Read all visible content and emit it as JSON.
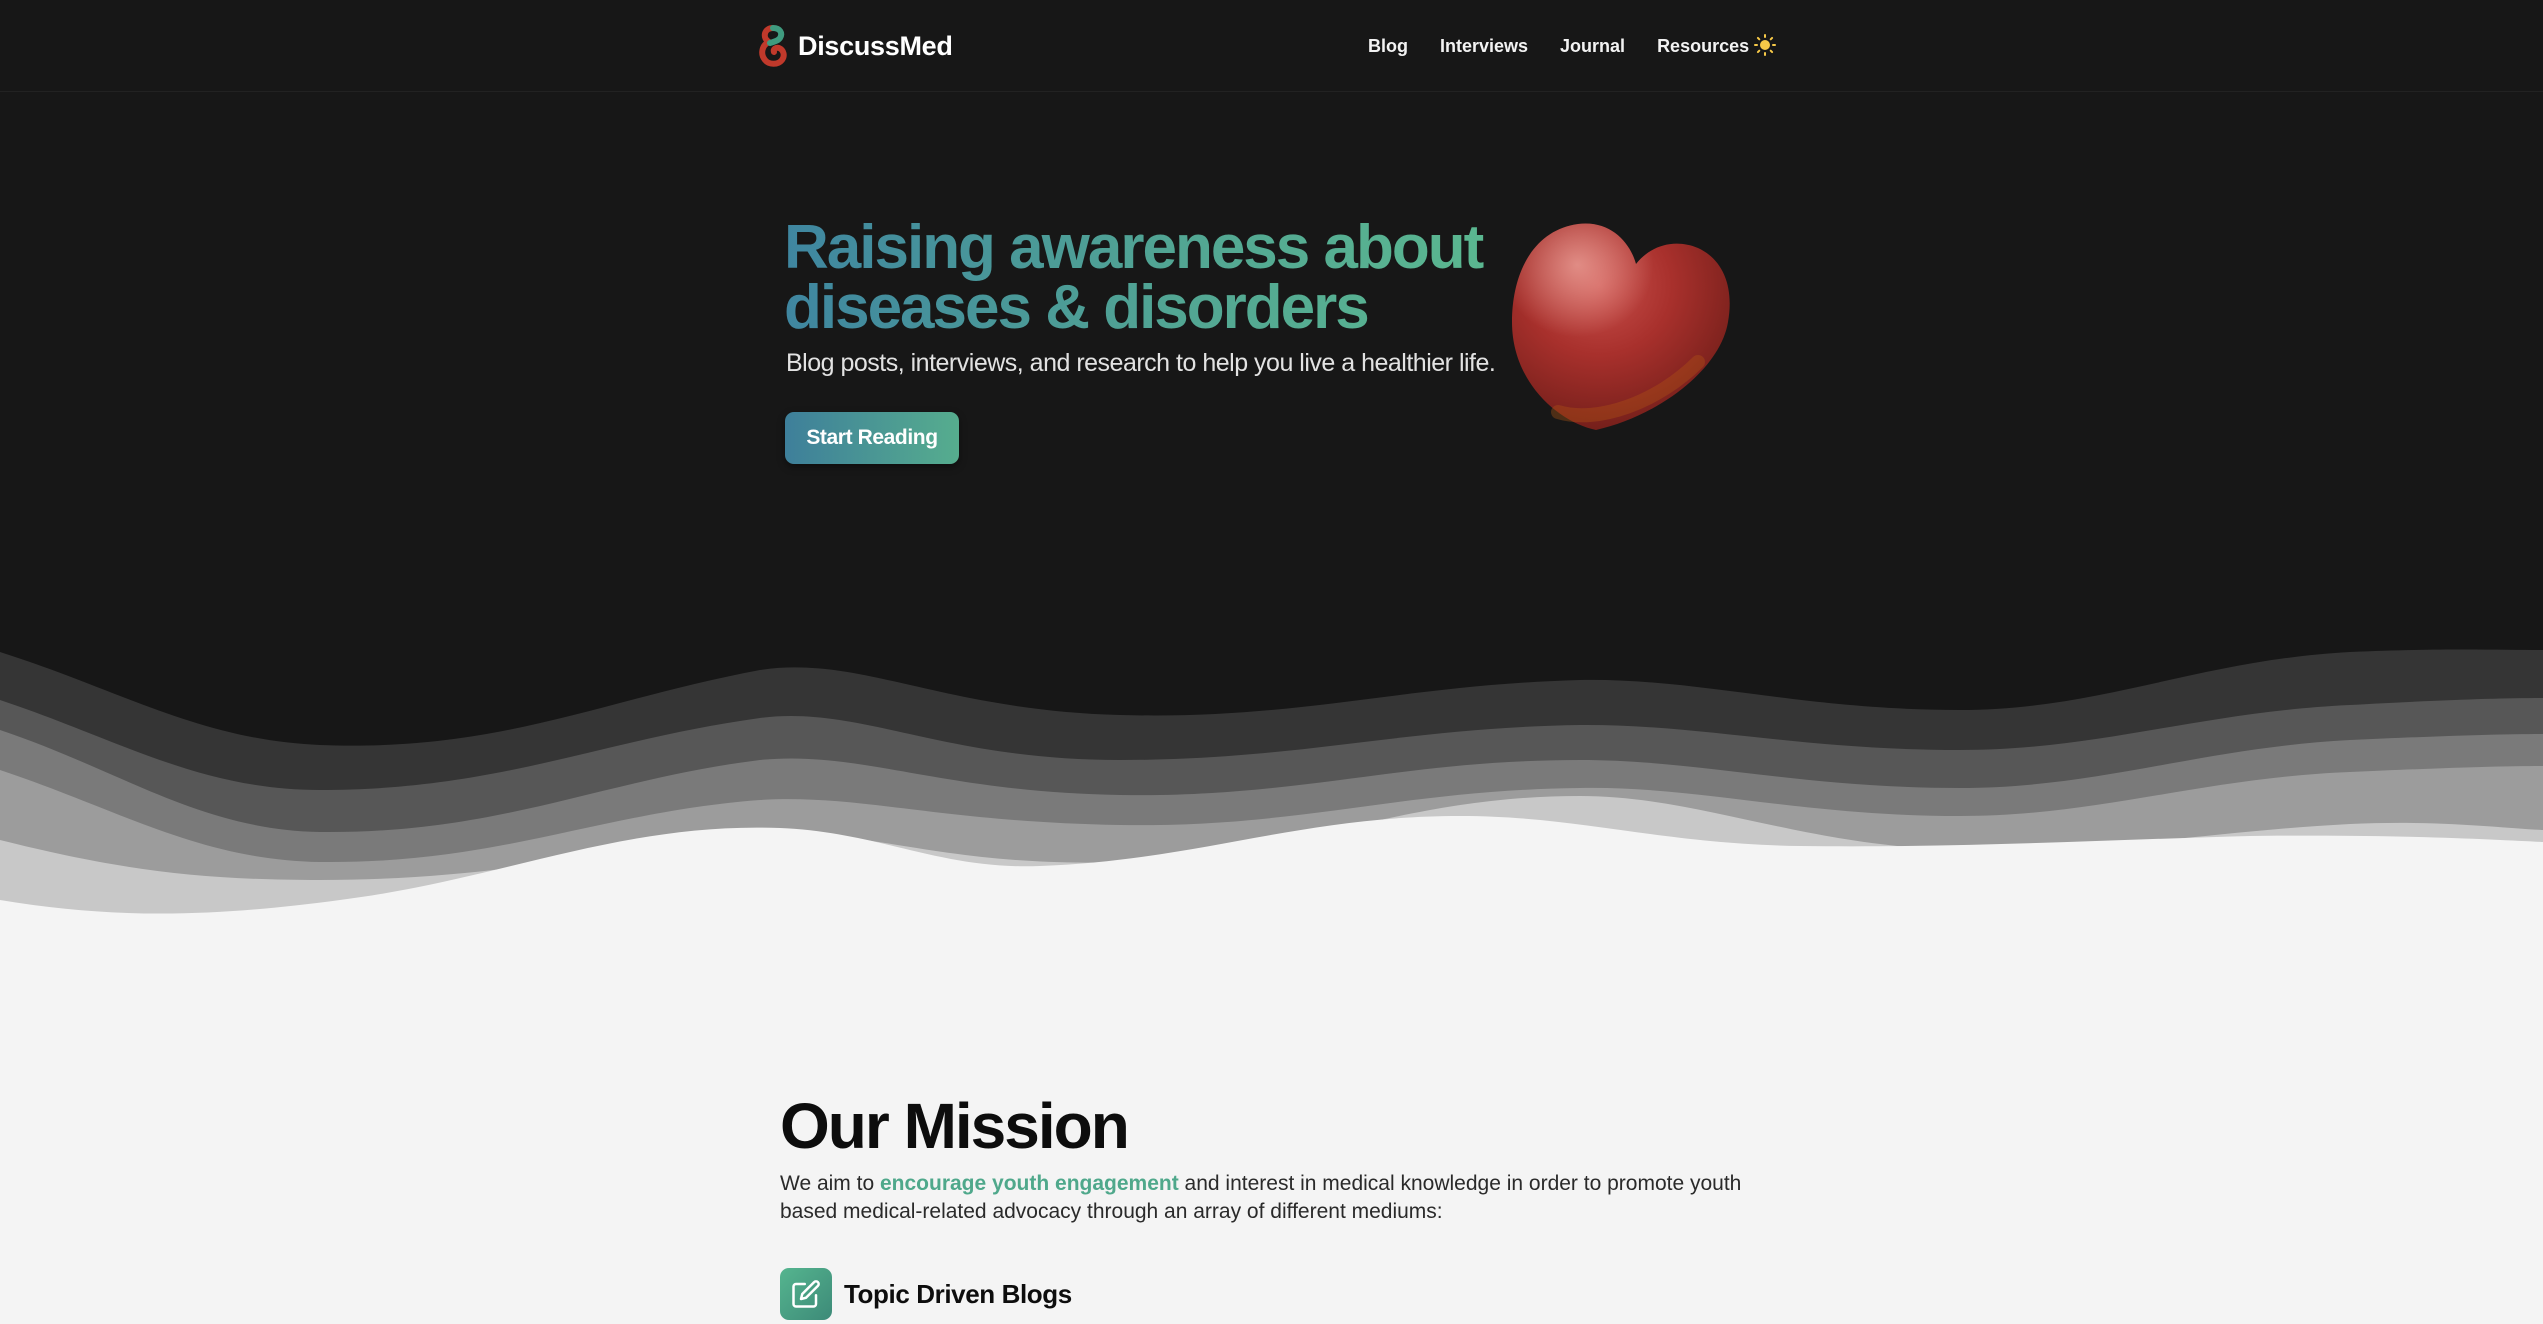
{
  "nav": {
    "brand": "DiscussMed",
    "links": [
      "Blog",
      "Interviews",
      "Journal",
      "Resources"
    ],
    "theme_icon": "sun-icon"
  },
  "hero": {
    "title": "Raising awareness about diseases & disorders",
    "subtitle": "Blog posts, interviews, and research to help you live a healthier life.",
    "cta": "Start Reading",
    "image": "heart-icon"
  },
  "mission": {
    "title": "Our Mission",
    "text_before": "We aim to ",
    "highlight": "encourage youth engagement",
    "text_after": " and interest in medical knowledge in order to promote youth based medical-related advocacy through an array of different mediums:",
    "features": [
      {
        "icon": "edit-icon",
        "title": "Topic Driven Blogs"
      }
    ]
  },
  "colors": {
    "background_dark": "#171717",
    "background_light": "#f4f4f4",
    "accent_blue": "#3f86a0",
    "accent_green": "#52a693"
  }
}
